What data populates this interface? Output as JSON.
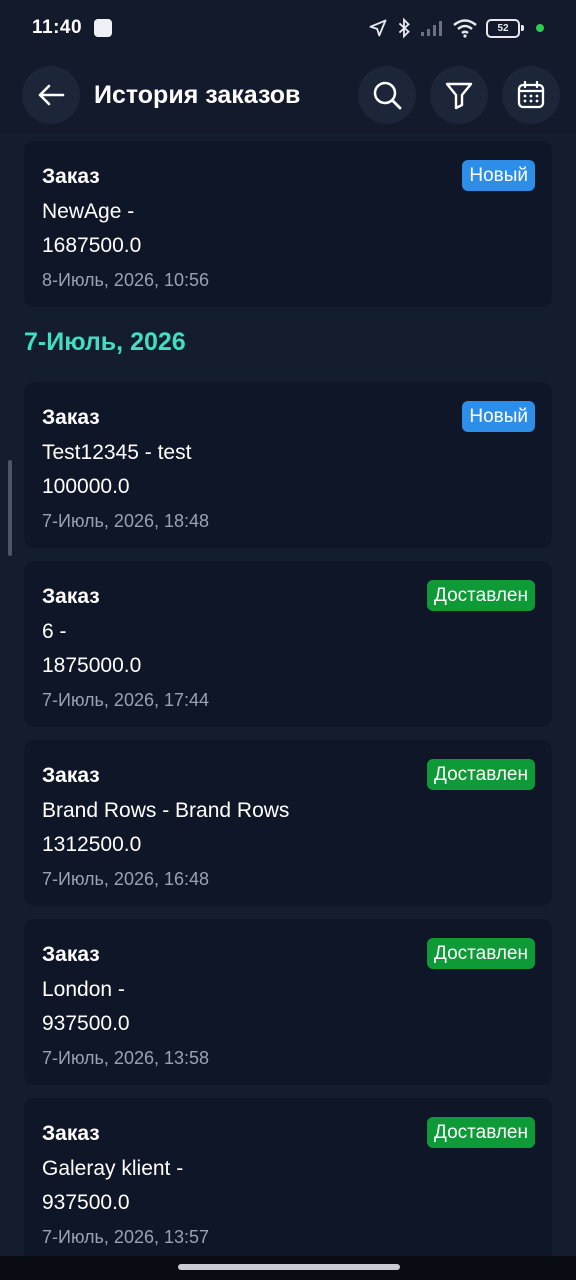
{
  "status_bar": {
    "time": "11:40",
    "battery": "52"
  },
  "header": {
    "title": "История заказов"
  },
  "date_group": "7-Июль, 2026",
  "orders": [
    {
      "title": "Заказ",
      "name": "NewAge -",
      "amount": "1687500.0",
      "date": "8-Июль, 2026, 10:56",
      "status": "Новый"
    },
    {
      "title": "Заказ",
      "name": "Test12345 - test",
      "amount": "100000.0",
      "date": "7-Июль, 2026, 18:48",
      "status": "Новый"
    },
    {
      "title": "Заказ",
      "name": "6 -",
      "amount": "1875000.0",
      "date": "7-Июль, 2026, 17:44",
      "status": "Доставлен"
    },
    {
      "title": "Заказ",
      "name": "Brand Rows - Brand Rows",
      "amount": "1312500.0",
      "date": "7-Июль, 2026, 16:48",
      "status": "Доставлен"
    },
    {
      "title": "Заказ",
      "name": "London -",
      "amount": "937500.0",
      "date": "7-Июль, 2026, 13:58",
      "status": "Доставлен"
    },
    {
      "title": "Заказ",
      "name": "Galeray klient -",
      "amount": "937500.0",
      "date": "7-Июль, 2026, 13:57",
      "status": "Доставлен"
    }
  ],
  "colors": {
    "background": "#121a2b",
    "card": "#0f1628",
    "accent_date": "#40dfc4",
    "badge_new": "#2d8ee9",
    "badge_delivered": "#0e9a36"
  },
  "icons": [
    "back-arrow-icon",
    "search-icon",
    "filter-icon",
    "calendar-icon",
    "location-icon",
    "bluetooth-icon",
    "signal-icon",
    "wifi-icon",
    "battery-icon"
  ]
}
